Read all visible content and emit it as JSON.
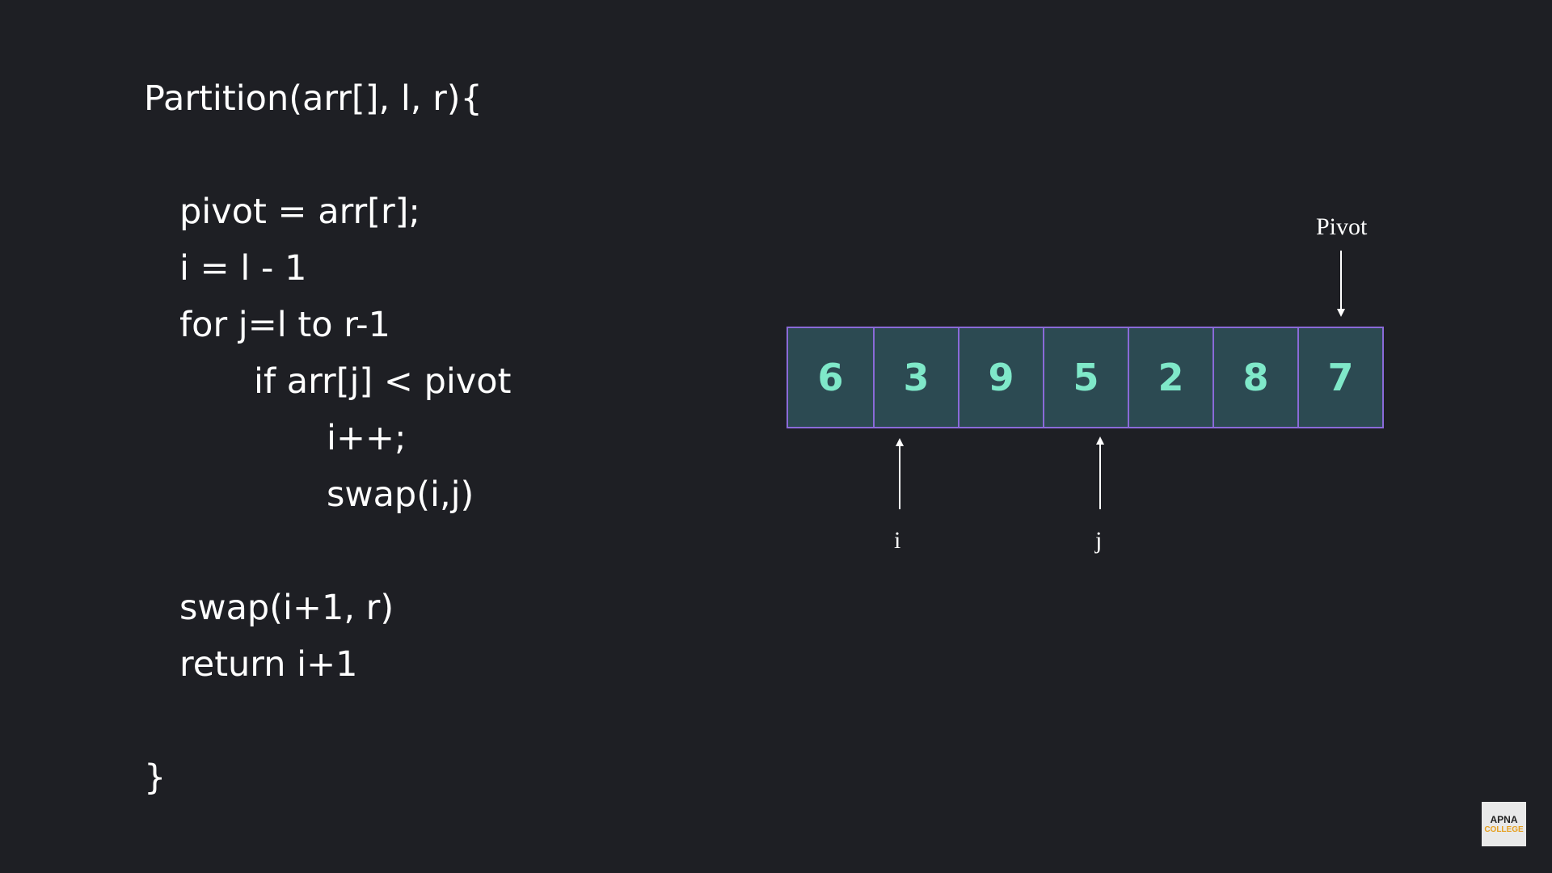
{
  "code": {
    "lines": [
      "Partition(arr[], l, r){",
      "pivot = arr[r];",
      "i = l - 1",
      "for j=l to r-1",
      "if arr[j] < pivot",
      "i++;",
      "swap(i,j)",
      "swap(i+1, r)",
      "return i+1",
      "}"
    ]
  },
  "array": {
    "values": [
      "6",
      "3",
      "9",
      "5",
      "2",
      "8",
      "7"
    ]
  },
  "pointers": {
    "pivot_label": "Pivot",
    "i_label": "i",
    "j_label": "j"
  },
  "logo": {
    "line1": "APNA",
    "line2": "COLLEGE"
  },
  "colors": {
    "background": "#1e1f24",
    "cell_fill": "#2c4a52",
    "cell_border": "#8a6ad8",
    "cell_text": "#7fe8c9"
  },
  "icons": [
    "pivot-arrow-icon",
    "i-arrow-icon",
    "j-arrow-icon"
  ]
}
